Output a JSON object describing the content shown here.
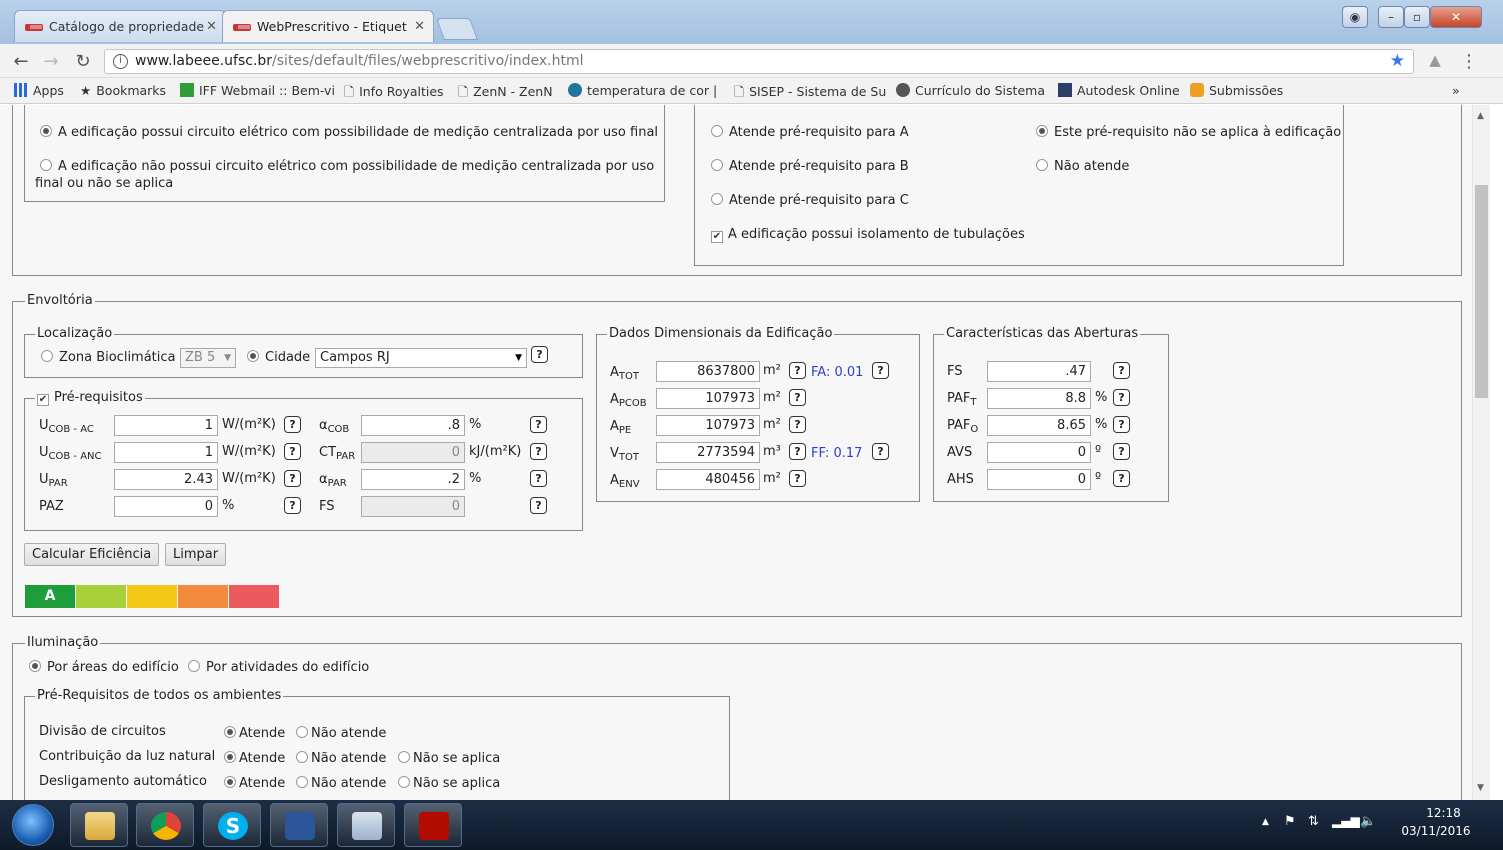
{
  "browser": {
    "tabs": [
      {
        "label": "Catálogo de propriedade",
        "active": false
      },
      {
        "label": "WebPrescritivo - Etiquet",
        "active": true
      }
    ],
    "url_host": "www.labeee.ufsc.br",
    "url_path": "/sites/default/files/webprescritivo/index.html",
    "bookmarks": [
      "Apps",
      "Bookmarks",
      "IFF Webmail :: Bem-vi",
      "Info Royalties",
      "ZenN - ZenN",
      "temperatura de cor |",
      "SISEP - Sistema de Su",
      "Currículo do Sistema",
      "Autodesk Online",
      "Submissões"
    ],
    "bookmarks_more": "»"
  },
  "top": {
    "opt1": "A edificação possui circuito elétrico com possibilidade de medição centralizada por uso final",
    "opt2_line1": "A edificação não possui circuito elétrico com possibilidade de medição centralizada por uso",
    "opt2_line2": "final ou não se aplica",
    "req_a": "Atende pré-requisito para A",
    "req_b": "Atende pré-requisito para B",
    "req_c": "Atende pré-requisito para C",
    "req_na": "Este pré-requisito não se aplica à edificação",
    "req_no": "Não atende",
    "insulation": "A edificação possui isolamento de tubulações"
  },
  "envoltoria": {
    "legend": "Envoltória",
    "localizacao": {
      "legend": "Localização",
      "zona_label": "Zona Bioclimática",
      "zona_value": "ZB 5",
      "cidade_label": "Cidade",
      "cidade_value": "Campos RJ"
    },
    "prereq": {
      "legend": "Pré-requisitos",
      "ucob_ac": "1",
      "ucob_ac_unit": "W/(m²K)",
      "ucob_anc": "1",
      "ucob_anc_unit": "W/(m²K)",
      "upar": "2.43",
      "upar_unit": "W/(m²K)",
      "paz": "0",
      "paz_unit": "%",
      "acob": ".8",
      "acob_unit": "%",
      "ctpar": "0",
      "ctpar_unit": "kJ/(m²K)",
      "apar": ".2",
      "apar_unit": "%",
      "fs_label": "FS",
      "fs": "0"
    },
    "dados": {
      "legend": "Dados Dimensionais da Edificação",
      "atot": "8637800",
      "apcob": "107973",
      "ape": "107973",
      "vtot": "2773594",
      "aenv": "480456",
      "unit_m2": "m²",
      "unit_m3": "m³",
      "fa": "FA: 0.01",
      "ff": "FF: 0.17"
    },
    "aberturas": {
      "legend": "Características das Aberturas",
      "fs_label": "FS",
      "fs": ".47",
      "paft": "8.8",
      "pafo": "8.65",
      "avs": "0",
      "ahs": "0",
      "avs_label": "AVS",
      "ahs_label": "AHS",
      "pct": "%",
      "deg": "º"
    },
    "calc_button": "Calcular Eficiência",
    "clear_button": "Limpar",
    "rating_letter": "A",
    "rating_colors": [
      "#1e9e3a",
      "#a6cf38",
      "#f4c817",
      "#f28b3c",
      "#ec5a5e"
    ]
  },
  "iluminacao": {
    "legend": "Iluminação",
    "opt_areas": "Por áreas do edifício",
    "opt_atividades": "Por atividades do edifício",
    "prereq_legend": "Pré-Requisitos de todos os ambientes",
    "rows": [
      {
        "label": "Divisão de circuitos"
      },
      {
        "label": "Contribuição da luz natural"
      },
      {
        "label": "Desligamento automático"
      }
    ],
    "atende": "Atende",
    "nao_atende": "Não atende",
    "nao_se_aplica": "Não se aplica"
  },
  "taskbar": {
    "time": "12:18",
    "date": "03/11/2016"
  }
}
